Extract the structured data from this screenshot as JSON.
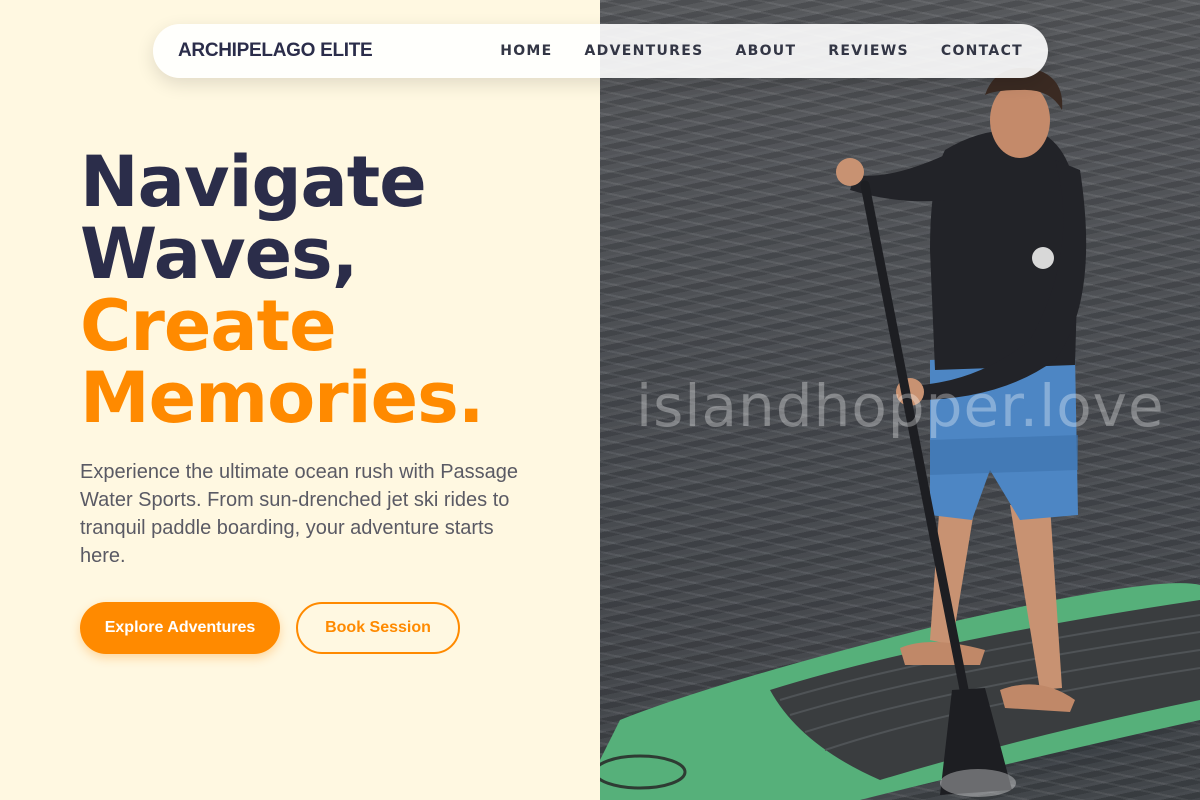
{
  "brand": {
    "name": "ARCHIPELAGO ELITE"
  },
  "nav": {
    "items": [
      "HOME",
      "ADVENTURES",
      "ABOUT",
      "REVIEWS",
      "CONTACT"
    ]
  },
  "hero": {
    "line1": "Navigate",
    "line2": "Waves,",
    "line3": "Create",
    "line4": "Memories.",
    "description": "Experience the ultimate ocean rush with Passage Water Sports. From sun-drenched jet ski rides to tranquil paddle boarding, your adventure starts here.",
    "primary_cta": "Explore Adventures",
    "secondary_cta": "Book Session"
  },
  "image": {
    "watermark": "islandhopper.love"
  },
  "colors": {
    "background": "#fff8e1",
    "primary": "#2b2d4a",
    "accent": "#ff8a00",
    "text": "#5a5a64"
  }
}
